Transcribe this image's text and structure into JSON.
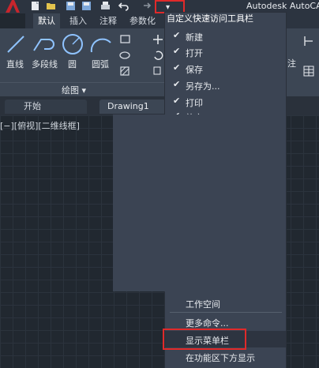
{
  "app_title": "Autodesk AutoCA",
  "ribbon_tabs": [
    "默认",
    "插入",
    "注释",
    "参数化"
  ],
  "ribbon_tools": [
    "直线",
    "多段线",
    "圆",
    "圆弧"
  ],
  "ribbon_panel": "绘图 ▾",
  "right_fragment": "注",
  "doc_tabs": {
    "start": "开始",
    "drawing": "Drawing1"
  },
  "viewport_label": "[−][俯视][二维线框]",
  "menu": {
    "title": "自定义快速访问工具栏",
    "checked_items": [
      "新建",
      "打开",
      "保存",
      "另存为...",
      "打印",
      "放弃"
    ],
    "bottom_items": [
      "工作空间",
      "更多命令...",
      "显示菜单栏",
      "在功能区下方显示"
    ],
    "highlighted": "显示菜单栏"
  },
  "icons": {
    "qa": [
      "file-new-icon",
      "open-folder-icon",
      "save-icon",
      "save-as-icon",
      "print-icon",
      "undo-icon",
      "redo-icon"
    ],
    "dropdown": "▾",
    "check": "✔"
  },
  "colors": {
    "highlight_border": "#e02a2a",
    "menu_bg": "#3b4453",
    "canvas_bg": "#212830"
  }
}
